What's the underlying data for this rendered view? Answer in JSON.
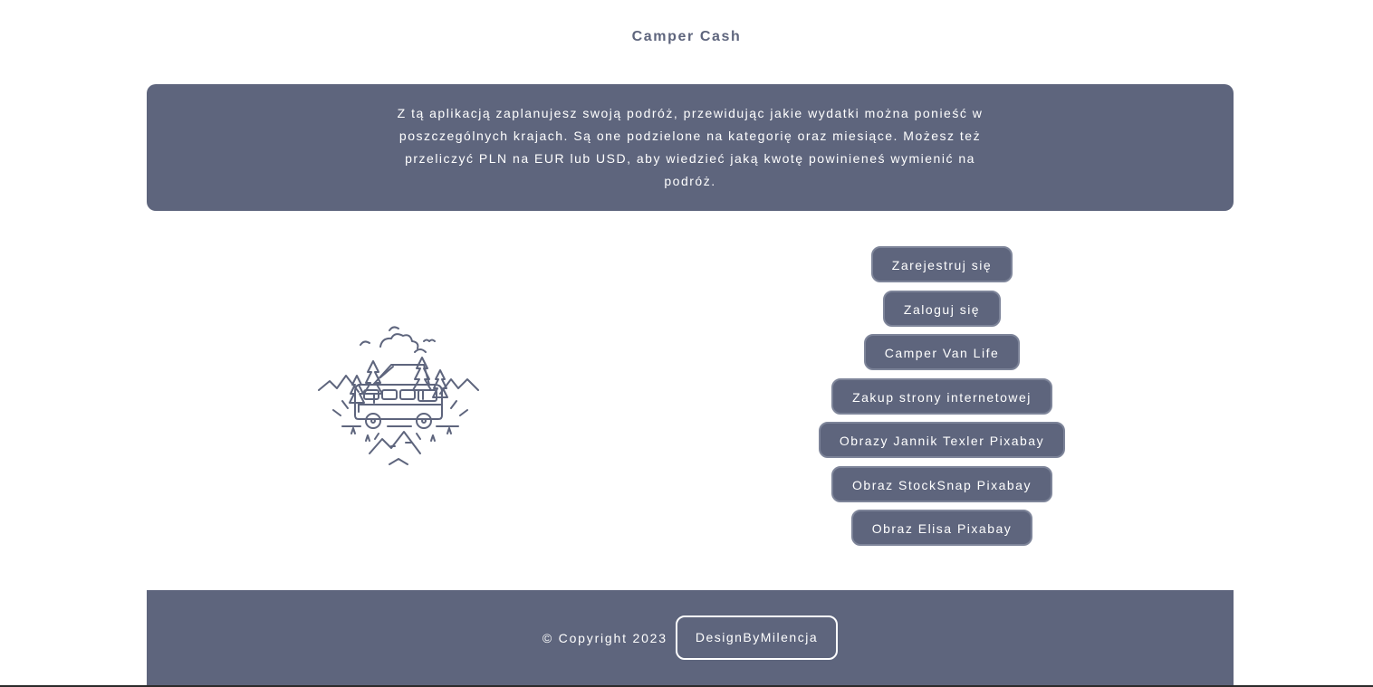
{
  "header": {
    "title": "Camper Cash"
  },
  "intro": {
    "text": "Z tą aplikacją zaplanujesz swoją podróż, przewidując jakie wydatki można ponieść w poszczególnych krajach. Są one podzielone na kategorię oraz miesiące. Możesz też przeliczyć PLN na EUR lub USD, aby wiedzieć jaką kwotę powinieneś wymienić na podróż."
  },
  "illustration": {
    "icon": "camper-van-illustration-icon"
  },
  "links": [
    {
      "label": "Zarejestruj się"
    },
    {
      "label": "Zaloguj się"
    },
    {
      "label": "Camper Van Life"
    },
    {
      "label": "Zakup strony internetowej"
    },
    {
      "label": "Obrazy Jannik Texler Pixabay"
    },
    {
      "label": "Obraz StockSnap Pixabay"
    },
    {
      "label": "Obraz Elisa Pixabay"
    }
  ],
  "footer": {
    "copyright": "© Copyright 2023",
    "designer_label": "DesignByMilencja"
  },
  "colors": {
    "primary": "#5e657d",
    "background": "#ffffff",
    "text_on_primary": "#ffffff"
  }
}
